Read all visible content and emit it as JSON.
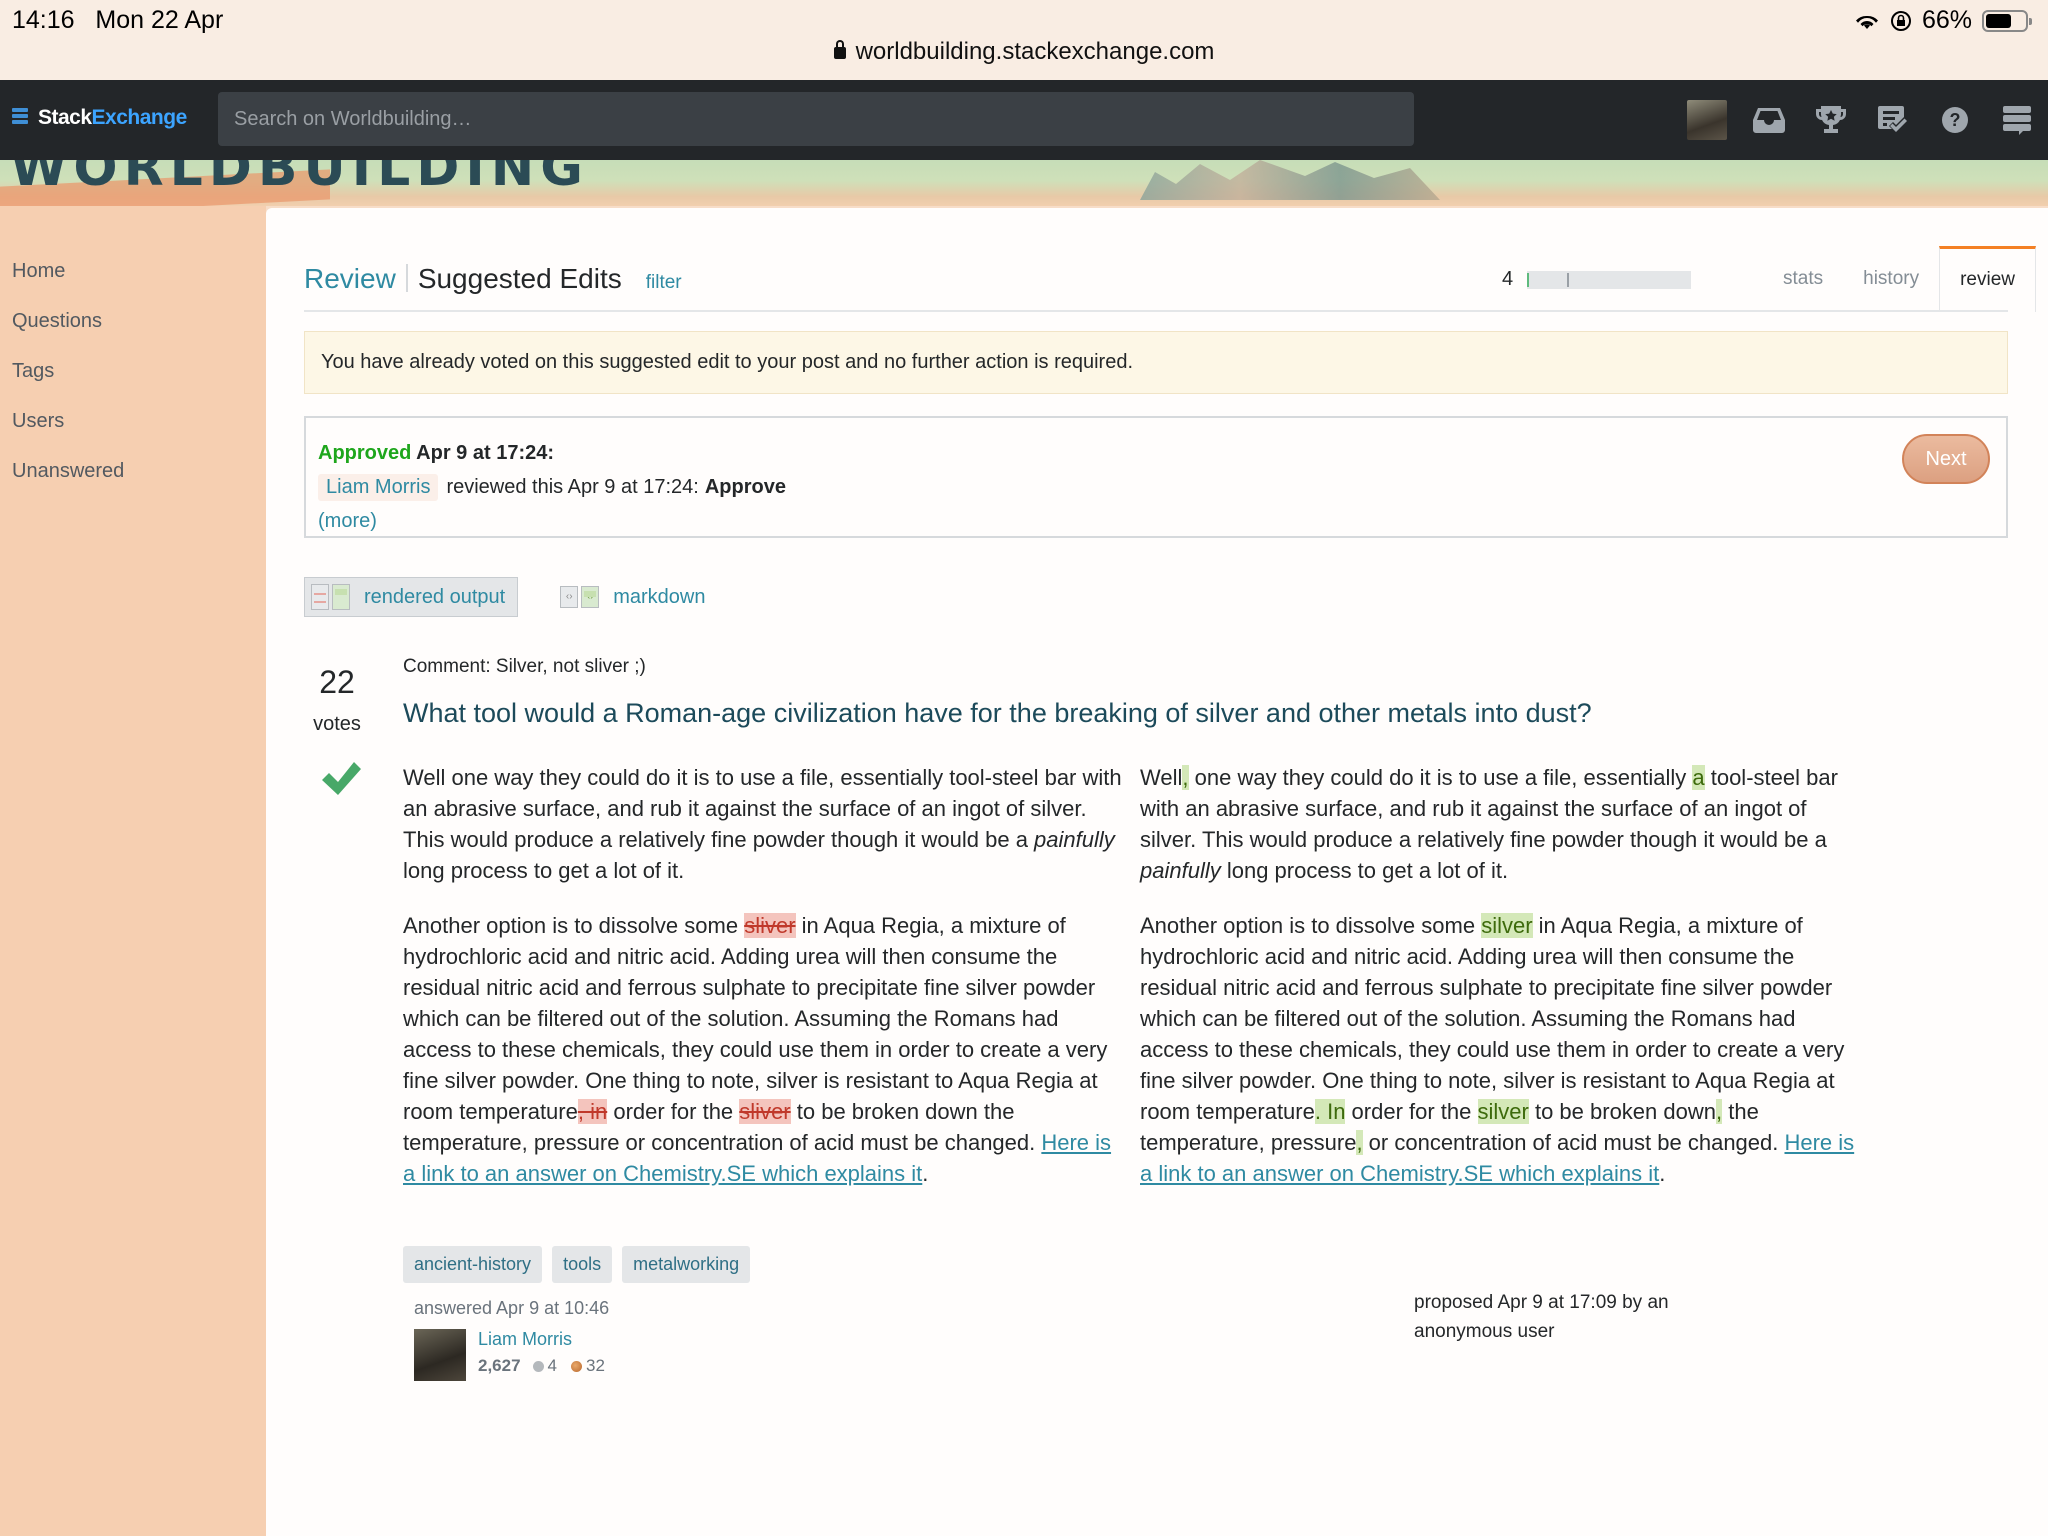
{
  "status_bar": {
    "time": "14:16",
    "date": "Mon 22 Apr",
    "battery": "66%",
    "battery_level": 0.66
  },
  "browser": {
    "url": "worldbuilding.stackexchange.com"
  },
  "topbar": {
    "logo_stack": "Stack",
    "logo_exchange": "Exchange",
    "search_placeholder": "Search on Worldbuilding…",
    "icons": [
      "avatar",
      "inbox-icon",
      "achievements-icon",
      "review-queue-icon",
      "help-icon",
      "site-switcher-icon"
    ]
  },
  "banner": {
    "site_name": "WORLDBUILDING"
  },
  "sidebar": {
    "items": [
      {
        "label": "Home"
      },
      {
        "label": "Questions"
      },
      {
        "label": "Tags"
      },
      {
        "label": "Users"
      },
      {
        "label": "Unanswered"
      }
    ]
  },
  "header": {
    "review": "Review",
    "title": "Suggested Edits",
    "filter": "filter",
    "queue_count": "4",
    "tabs": [
      {
        "label": "stats",
        "active": false
      },
      {
        "label": "history",
        "active": false
      },
      {
        "label": "review",
        "active": true
      }
    ]
  },
  "notice": "You have already voted on this suggested edit to your post and no further action is required.",
  "review_result": {
    "status": "Approved",
    "status_time": "Apr 9 at 17:24:",
    "reviewer": "Liam Morris",
    "reviewed_text": "reviewed this Apr 9 at 17:24:",
    "action": "Approve",
    "more": "(more)",
    "next_button": "Next"
  },
  "view_toggle": {
    "rendered": "rendered output",
    "markdown": "markdown",
    "active": "rendered"
  },
  "post": {
    "votes": "22",
    "votes_label": "votes",
    "accepted": true,
    "comment": "Comment: Silver, not sliver ;)",
    "title": "What tool would a Roman-age civilization have for the breaking of silver and other metals into dust?",
    "original": {
      "p1": {
        "a": "Well one way they could do it is to use a file, essentially tool-steel bar with an abrasive surface, and rub it against the surface of an ingot of silver. This would produce a relatively fine powder though it would be a ",
        "em": "painfully",
        "b": " long process to get a lot of it."
      },
      "p2": {
        "a": "Another option is to dissolve some ",
        "del1": "sliver",
        "b": " in Aqua Regia, a mixture of hydrochloric acid and nitric acid. Adding urea will then consume the residual nitric acid and ferrous sulphate to precipitate fine silver powder which can be filtered out of the solution. Assuming the Romans had access to these chemicals, they could use them in order to create a very fine silver powder. One thing to note, silver is resistant to Aqua Regia at room temperature",
        "del2": ", in",
        "c": " order for the ",
        "del3": "sliver",
        "d": " to be broken down the temperature, pressure or concentration of acid must be changed. ",
        "link": "Here is a link to an answer on Chemistry.SE which explains it",
        "e": "."
      }
    },
    "edited": {
      "p1": {
        "a": "Well",
        "ins1": ",",
        "b": " one way they could do it is to use a file, essentially ",
        "ins2": "a",
        "c": " tool-steel bar with an abrasive surface, and rub it against the surface of an ingot of silver. This would produce a relatively fine powder though it would be a ",
        "em": "painfully",
        "d": " long process to get a lot of it."
      },
      "p2": {
        "a": "Another option is to dissolve some ",
        "ins1": "silver",
        "b": " in Aqua Regia, a mixture of hydrochloric acid and nitric acid. Adding urea will then consume the residual nitric acid and ferrous sulphate to precipitate fine silver powder which can be filtered out of the solution. Assuming the Romans had access to these chemicals, they could use them in order to create a very fine silver powder. One thing to note, silver is resistant to Aqua Regia at room temperature",
        "ins2": ". In",
        "c": " order for the ",
        "ins3": "silver",
        "d": " to be broken down",
        "ins4": ",",
        "e": " the temperature, pressure",
        "ins5": ",",
        "f": " or concentration of acid must be changed. ",
        "link": "Here is a link to an answer on Chemistry.SE which explains it",
        "g": "."
      }
    },
    "tags": [
      "ancient-history",
      "tools",
      "metalworking"
    ],
    "answered": "answered Apr 9 at 10:46",
    "author": {
      "name": "Liam Morris",
      "reputation": "2,627",
      "silver": "4",
      "bronze": "32"
    },
    "proposed": "proposed Apr 9 at 17:09 by an anonymous user"
  }
}
